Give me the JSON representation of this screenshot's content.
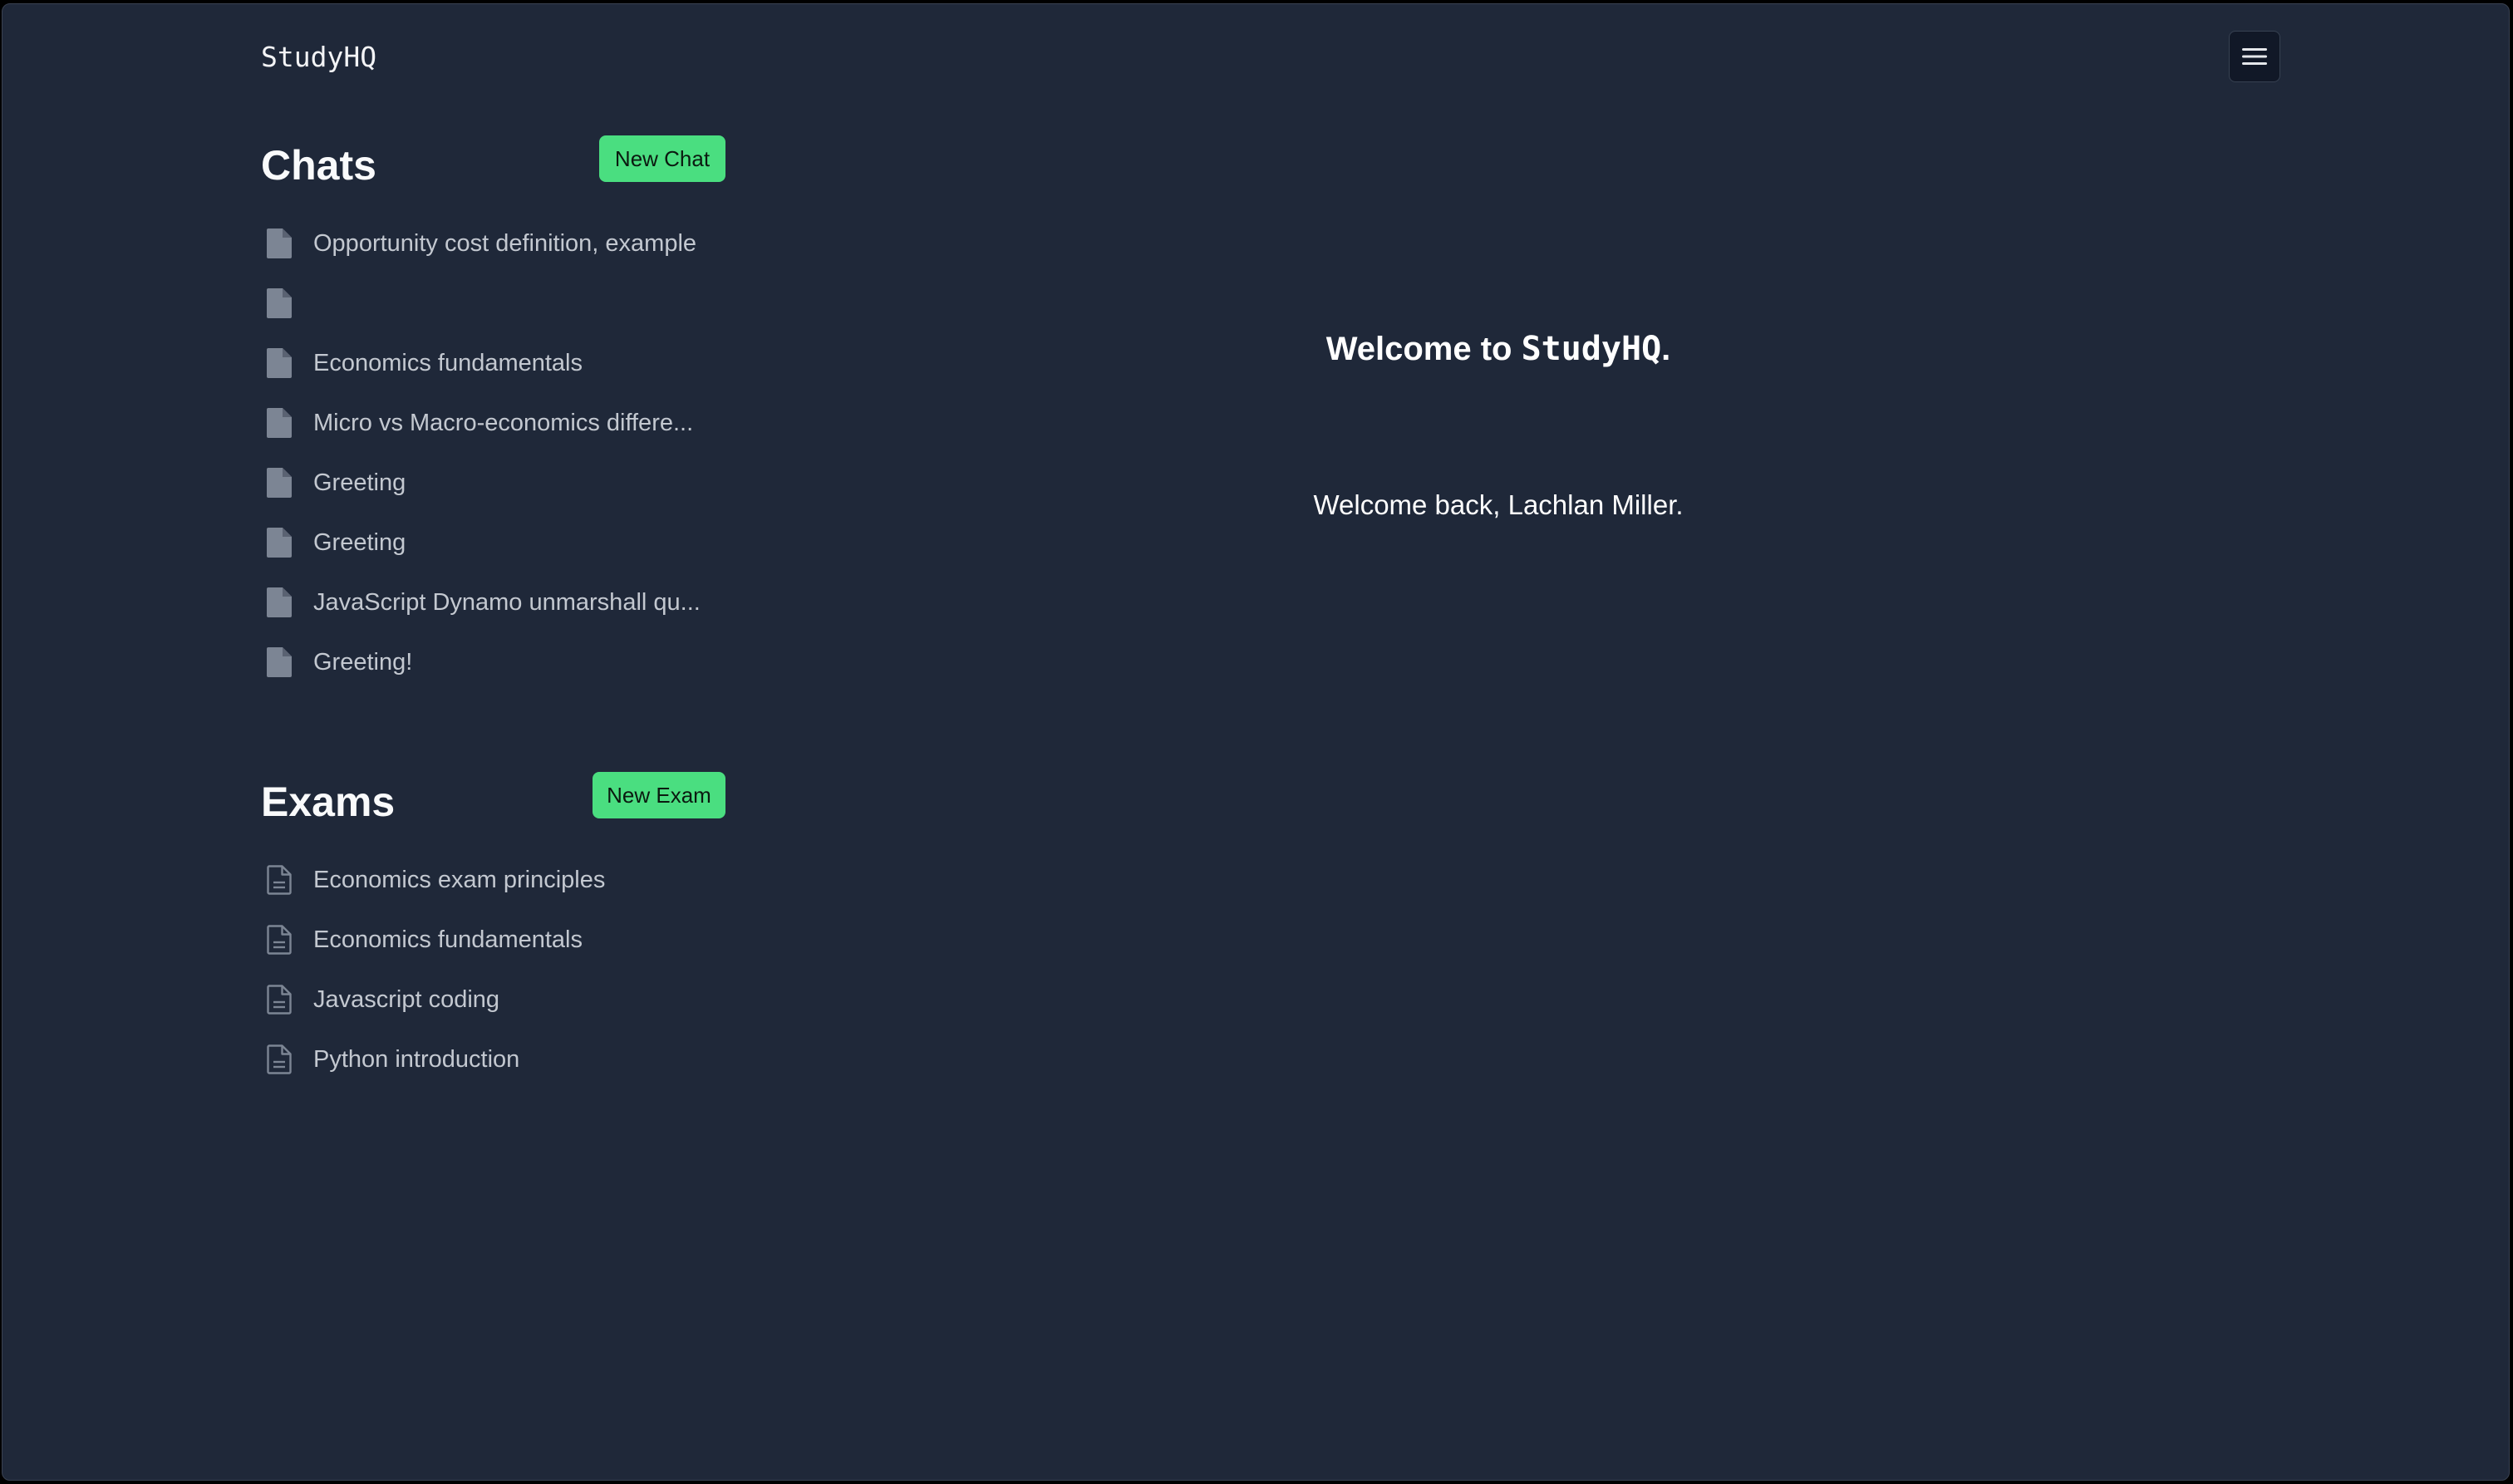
{
  "header": {
    "brand": "StudyHQ",
    "menu_icon": "hamburger-menu-icon"
  },
  "chats": {
    "title": "Chats",
    "new_button_label": "New Chat",
    "item_icon": "file-solid-icon",
    "items": [
      {
        "label": "Opportunity cost definition, example"
      },
      {
        "label": ""
      },
      {
        "label": "Economics fundamentals"
      },
      {
        "label": "Micro vs Macro-economics differe..."
      },
      {
        "label": "Greeting"
      },
      {
        "label": "Greeting"
      },
      {
        "label": "JavaScript Dynamo unmarshall qu..."
      },
      {
        "label": "Greeting!"
      }
    ]
  },
  "exams": {
    "title": "Exams",
    "new_button_label": "New Exam",
    "item_icon": "file-outline-icon",
    "items": [
      {
        "label": "Economics exam principles"
      },
      {
        "label": "Economics fundamentals"
      },
      {
        "label": "Javascript coding"
      },
      {
        "label": "Python introduction"
      }
    ]
  },
  "main": {
    "welcome_prefix": "Welcome to ",
    "welcome_brand": "StudyHQ",
    "welcome_suffix": ".",
    "welcome_back": "Welcome back, Lachlan Miller."
  },
  "colors": {
    "background": "#1f2839",
    "accent_green": "#4ade80",
    "text_primary": "#ffffff",
    "text_muted": "#c3c8d0",
    "icon_gray": "#7c8594"
  }
}
